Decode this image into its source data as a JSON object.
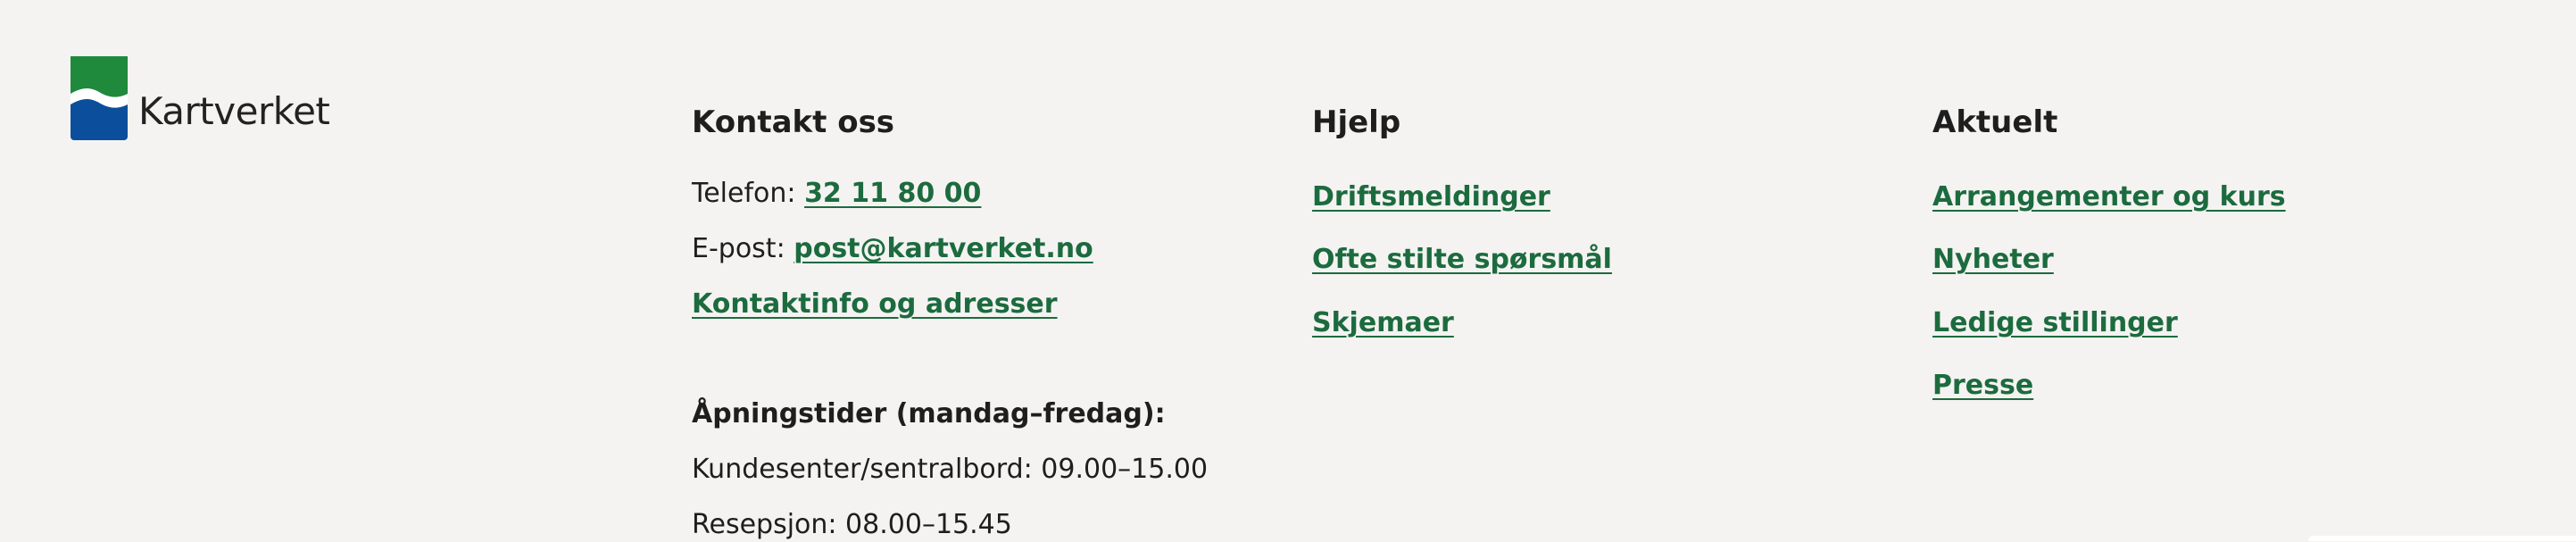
{
  "logo": {
    "text": "Kartverket"
  },
  "contact": {
    "heading": "Kontakt oss",
    "phone_label": "Telefon:",
    "phone_value": "32 11 80 00",
    "email_label": "E-post:",
    "email_value": "post@kartverket.no",
    "contact_link": "Kontaktinfo og adresser",
    "hours_heading": "Åpningstider (mandag–fredag):",
    "hours_customer": "Kundesenter/sentralbord: 09.00–15.00",
    "hours_reception": "Resepsjon: 08.00–15.45"
  },
  "help": {
    "heading": "Hjelp",
    "links": [
      "Driftsmeldinger",
      "Ofte stilte spørsmål",
      "Skjemaer"
    ]
  },
  "news": {
    "heading": "Aktuelt",
    "links": [
      "Arrangementer og kurs",
      "Nyheter",
      "Ledige stillinger",
      "Presse"
    ]
  },
  "colors": {
    "link": "#1c6b3e",
    "logo_green": "#1f8a3c",
    "logo_blue": "#0b4f9c",
    "background": "#f4f3f2"
  }
}
